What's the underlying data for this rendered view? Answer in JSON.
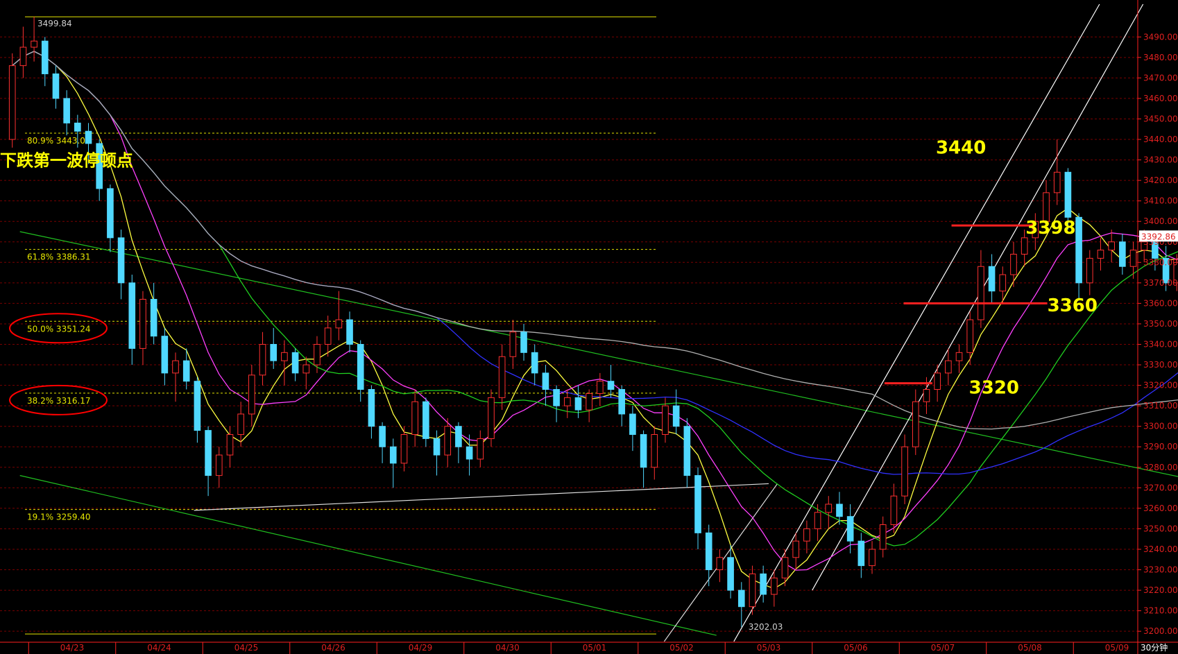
{
  "chart_data": {
    "type": "candlestick",
    "period_label": "30分钟",
    "y_range": [
      3196,
      3506
    ],
    "y_ticks": [
      3200,
      3210,
      3220,
      3230,
      3240,
      3250,
      3260,
      3270,
      3280,
      3290,
      3300,
      3310,
      3320,
      3330,
      3340,
      3350,
      3360,
      3370,
      3380,
      3390,
      3400,
      3410,
      3420,
      3430,
      3440,
      3450,
      3460,
      3470,
      3480,
      3490
    ],
    "x_labels": [
      "04/23",
      "04/24",
      "04/25",
      "04/26",
      "04/29",
      "04/30",
      "05/01",
      "05/02",
      "05/03",
      "05/06",
      "05/07",
      "05/08",
      "05/09"
    ],
    "bars_per_day": 8,
    "current_price": "3392.86",
    "high_label": "3499.84",
    "low_label": "3202.03",
    "fib_levels": [
      {
        "pct": "80.9%",
        "value": 3443.07,
        "label": "80.9% 3443.07",
        "circled": false
      },
      {
        "pct": "61.8%",
        "value": 3386.31,
        "label": "61.8% 3386.31",
        "circled": false
      },
      {
        "pct": "50.0%",
        "value": 3351.24,
        "label": "50.0% 3351.24",
        "circled": true
      },
      {
        "pct": "38.2%",
        "value": 3316.17,
        "label": "38.2% 3316.17",
        "circled": true
      },
      {
        "pct": "19.1%",
        "value": 3259.4,
        "label": "19.1% 3259.40",
        "circled": false
      }
    ],
    "annotations": [
      {
        "text": "下跌第一波停顿点",
        "day": 0.0,
        "price": 3427,
        "style": "cn"
      },
      {
        "text": "3440",
        "day": 9.92,
        "price": 3433,
        "style": "big"
      },
      {
        "text": "3398",
        "day": 10.95,
        "price": 3394,
        "style": "big"
      },
      {
        "text": "3360",
        "day": 11.2,
        "price": 3356,
        "style": "big"
      },
      {
        "text": "3320",
        "day": 10.3,
        "price": 3316,
        "style": "big"
      }
    ],
    "horizontal_marks": [
      {
        "value": 3398,
        "from_day": 10.1,
        "to_day": 11.03,
        "color": "#ff2020"
      },
      {
        "value": 3360,
        "from_day": 9.55,
        "to_day": 11.2,
        "color": "#ff2020"
      },
      {
        "value": 3321,
        "from_day": 9.33,
        "to_day": 9.88,
        "color": "#ff2020"
      }
    ],
    "trend_lines": [
      {
        "color": "#20c020",
        "points": [
          [
            -0.6,
            3395
          ],
          [
            13.2,
            3271
          ]
        ]
      },
      {
        "color": "#20c020",
        "points": [
          [
            -0.6,
            3276
          ],
          [
            7.4,
            3198
          ]
        ]
      },
      {
        "color": "#e0e0e0",
        "points": [
          [
            1.4,
            3259
          ],
          [
            8.0,
            3272
          ]
        ]
      },
      {
        "color": "#e0e0e0",
        "points": [
          [
            6.8,
            3195
          ],
          [
            8.1,
            3272
          ]
        ]
      },
      {
        "color": "#ffffff",
        "points": [
          [
            7.6,
            3195
          ],
          [
            11.8,
            3506
          ]
        ]
      },
      {
        "color": "#ffffff",
        "points": [
          [
            8.5,
            3220
          ],
          [
            12.3,
            3506
          ]
        ]
      }
    ],
    "ohlc": [
      [
        3440,
        3482,
        3436,
        3476
      ],
      [
        3476,
        3495,
        3470,
        3485
      ],
      [
        3485,
        3499.84,
        3478,
        3488
      ],
      [
        3488,
        3490,
        3466,
        3472
      ],
      [
        3472,
        3476,
        3455,
        3460
      ],
      [
        3460,
        3464,
        3442,
        3448
      ],
      [
        3448,
        3452,
        3436,
        3444
      ],
      [
        3444,
        3448,
        3428,
        3438
      ],
      [
        3438,
        3440,
        3410,
        3416
      ],
      [
        3416,
        3418,
        3385,
        3392
      ],
      [
        3392,
        3396,
        3362,
        3370
      ],
      [
        3370,
        3374,
        3330,
        3338
      ],
      [
        3338,
        3366,
        3330,
        3362
      ],
      [
        3362,
        3370,
        3340,
        3344
      ],
      [
        3344,
        3348,
        3320,
        3326
      ],
      [
        3326,
        3336,
        3312,
        3332
      ],
      [
        3332,
        3338,
        3318,
        3322
      ],
      [
        3322,
        3324,
        3292,
        3298
      ],
      [
        3298,
        3300,
        3266,
        3276
      ],
      [
        3276,
        3290,
        3270,
        3286
      ],
      [
        3286,
        3300,
        3280,
        3296
      ],
      [
        3296,
        3312,
        3290,
        3306
      ],
      [
        3306,
        3330,
        3300,
        3325
      ],
      [
        3325,
        3346,
        3320,
        3340
      ],
      [
        3340,
        3348,
        3328,
        3332
      ],
      [
        3332,
        3342,
        3320,
        3336
      ],
      [
        3336,
        3338,
        3322,
        3326
      ],
      [
        3326,
        3334,
        3318,
        3330
      ],
      [
        3330,
        3344,
        3326,
        3340
      ],
      [
        3340,
        3354,
        3334,
        3348
      ],
      [
        3348,
        3366,
        3342,
        3352
      ],
      [
        3352,
        3356,
        3336,
        3340
      ],
      [
        3340,
        3342,
        3312,
        3318
      ],
      [
        3318,
        3320,
        3294,
        3300
      ],
      [
        3300,
        3302,
        3282,
        3290
      ],
      [
        3290,
        3294,
        3270,
        3282
      ],
      [
        3282,
        3300,
        3278,
        3296
      ],
      [
        3296,
        3318,
        3290,
        3312
      ],
      [
        3312,
        3314,
        3290,
        3294
      ],
      [
        3294,
        3298,
        3276,
        3286
      ],
      [
        3286,
        3304,
        3280,
        3300
      ],
      [
        3300,
        3302,
        3282,
        3290
      ],
      [
        3290,
        3296,
        3276,
        3284
      ],
      [
        3284,
        3298,
        3280,
        3294
      ],
      [
        3294,
        3318,
        3290,
        3314
      ],
      [
        3314,
        3340,
        3308,
        3334
      ],
      [
        3334,
        3352,
        3328,
        3346
      ],
      [
        3346,
        3350,
        3332,
        3336
      ],
      [
        3336,
        3340,
        3320,
        3326
      ],
      [
        3326,
        3330,
        3310,
        3318
      ],
      [
        3318,
        3320,
        3302,
        3310
      ],
      [
        3310,
        3318,
        3304,
        3314
      ],
      [
        3314,
        3320,
        3304,
        3308
      ],
      [
        3308,
        3318,
        3302,
        3316
      ],
      [
        3316,
        3326,
        3310,
        3322
      ],
      [
        3322,
        3330,
        3314,
        3318
      ],
      [
        3318,
        3320,
        3300,
        3306
      ],
      [
        3306,
        3310,
        3288,
        3296
      ],
      [
        3296,
        3298,
        3270,
        3280
      ],
      [
        3280,
        3300,
        3274,
        3296
      ],
      [
        3296,
        3314,
        3292,
        3310
      ],
      [
        3310,
        3318,
        3296,
        3300
      ],
      [
        3300,
        3304,
        3270,
        3276
      ],
      [
        3276,
        3280,
        3240,
        3248
      ],
      [
        3248,
        3252,
        3222,
        3230
      ],
      [
        3230,
        3240,
        3224,
        3236
      ],
      [
        3236,
        3242,
        3216,
        3220
      ],
      [
        3220,
        3224,
        3202.03,
        3212
      ],
      [
        3212,
        3232,
        3208,
        3228
      ],
      [
        3228,
        3232,
        3214,
        3218
      ],
      [
        3218,
        3230,
        3212,
        3226
      ],
      [
        3226,
        3240,
        3222,
        3236
      ],
      [
        3236,
        3248,
        3230,
        3244
      ],
      [
        3244,
        3254,
        3238,
        3250
      ],
      [
        3250,
        3262,
        3244,
        3258
      ],
      [
        3258,
        3266,
        3250,
        3262
      ],
      [
        3262,
        3268,
        3252,
        3256
      ],
      [
        3256,
        3262,
        3238,
        3244
      ],
      [
        3244,
        3248,
        3226,
        3232
      ],
      [
        3232,
        3244,
        3228,
        3240
      ],
      [
        3240,
        3256,
        3236,
        3252
      ],
      [
        3252,
        3272,
        3248,
        3266
      ],
      [
        3266,
        3296,
        3262,
        3290
      ],
      [
        3290,
        3318,
        3286,
        3312
      ],
      [
        3312,
        3324,
        3306,
        3318
      ],
      [
        3318,
        3330,
        3312,
        3326
      ],
      [
        3326,
        3338,
        3320,
        3332
      ],
      [
        3332,
        3340,
        3326,
        3336
      ],
      [
        3336,
        3356,
        3330,
        3352
      ],
      [
        3352,
        3386,
        3348,
        3378
      ],
      [
        3378,
        3384,
        3360,
        3366
      ],
      [
        3366,
        3378,
        3360,
        3374
      ],
      [
        3374,
        3390,
        3368,
        3384
      ],
      [
        3384,
        3396,
        3378,
        3392
      ],
      [
        3392,
        3404,
        3386,
        3400
      ],
      [
        3400,
        3420,
        3394,
        3414
      ],
      [
        3414,
        3440,
        3408,
        3424
      ],
      [
        3424,
        3426,
        3396,
        3402
      ],
      [
        3402,
        3404,
        3362,
        3370
      ],
      [
        3370,
        3386,
        3364,
        3382
      ],
      [
        3382,
        3392,
        3376,
        3386
      ],
      [
        3386,
        3396,
        3380,
        3390
      ],
      [
        3390,
        3394,
        3374,
        3378
      ],
      [
        3378,
        3390,
        3372,
        3386
      ],
      [
        3386,
        3396,
        3380,
        3390
      ],
      [
        3390,
        3394,
        3376,
        3382
      ],
      [
        3382,
        3388,
        3366,
        3370
      ],
      [
        3370,
        3384,
        3366,
        3380
      ],
      [
        3380,
        3398,
        3376,
        3392.86
      ]
    ],
    "moving_averages": [
      {
        "period": 5,
        "color": "#ffff40"
      },
      {
        "period": 10,
        "color": "#ff40ff"
      },
      {
        "period": 20,
        "color": "#20d020"
      },
      {
        "period": 40,
        "color": "#3030ff"
      },
      {
        "period": 80,
        "color": "#b0b0b0"
      }
    ],
    "colors": {
      "background": "#000000",
      "grid": "#7a0000",
      "up": "#ff3030",
      "down": "#50d8ff",
      "axis": "#ff2020",
      "fib_line": "#e6e600",
      "circle": "#ff0000",
      "price_box_bg": "#ffffff",
      "price_box_text": "#ff0000"
    }
  }
}
